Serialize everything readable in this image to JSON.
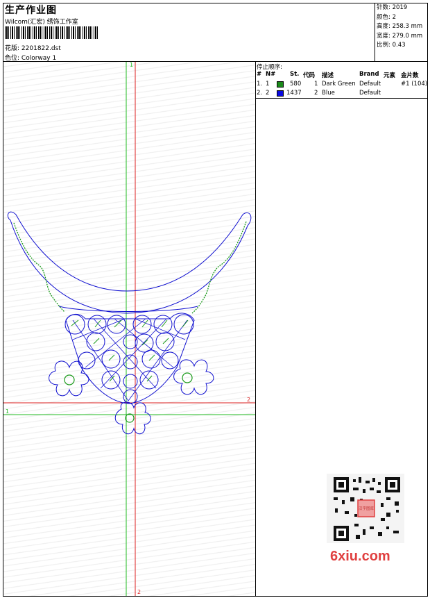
{
  "header": {
    "title": "生产作业图",
    "company": "Wilcom(汇宏) 绣饰工作室",
    "file_label": "花版:",
    "file_name": "2201822.dst",
    "colorway_label": "色位:",
    "colorway_name": "Colorway 1"
  },
  "stats": {
    "stitches_label": "针数:",
    "stitches": "2019",
    "colors_label": "颜色:",
    "colors": "2",
    "height_label": "高度:",
    "height": "258.3 mm",
    "width_label": "宽度:",
    "width": "279.0 mm",
    "scale_label": "比例:",
    "scale": "0.43"
  },
  "stop_sequence": {
    "heading": "停止顺序:",
    "columns": [
      "#",
      "N#",
      "St.",
      "代码",
      "描述",
      "Brand",
      "元素",
      "金片数"
    ],
    "rows": [
      {
        "idx": "1.",
        "n": "1",
        "color": "#1a8a1a",
        "st": "580",
        "code": "1",
        "desc": "Dark Green",
        "brand": "Default",
        "element": "#1 (104)"
      },
      {
        "idx": "2.",
        "n": "2",
        "color": "#0a0ae0",
        "st": "1437",
        "code": "2",
        "desc": "Blue",
        "brand": "Default",
        "element": ""
      }
    ]
  },
  "canvas": {
    "axis_labels": {
      "green_top": "1",
      "green_left": "1",
      "red_right": "2",
      "red_bottom": "2"
    },
    "colors": {
      "green": "#22bb22",
      "red": "#dd2222",
      "design_blue": "#1010d0",
      "design_green": "#1a9a1a"
    }
  },
  "watermark": {
    "text": "6xiu.com",
    "qr_badge": "汉字图库"
  }
}
